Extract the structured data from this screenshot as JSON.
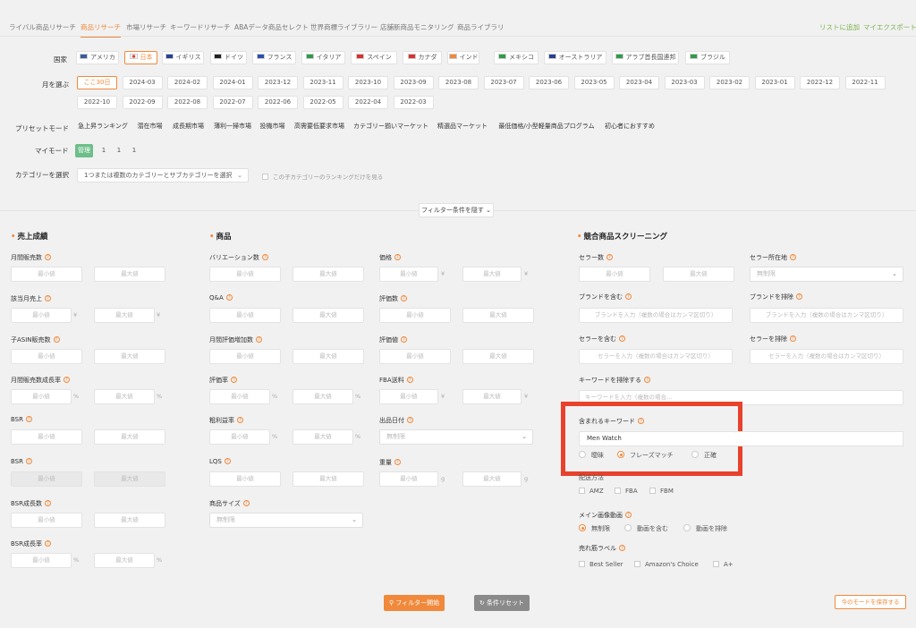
{
  "tabs": [
    "ライバル商品リサーチ",
    "商品リサーチ",
    "市場リサーチ",
    "キーワードリサーチ",
    "ABAデータ商品セレクト",
    "世界商標ライブラリー",
    "店舗新商品モニタリング",
    "商品ライブラリ"
  ],
  "top_links": {
    "add_list": "リストに追加",
    "my_export": "マイエクスポート"
  },
  "country": {
    "label": "国家",
    "items": [
      {
        "name": "アメリカ",
        "flag": "us-flag"
      },
      {
        "name": "日本",
        "flag": "jp-flag"
      },
      {
        "name": "イギリス",
        "flag": "uk-flag"
      },
      {
        "name": "ドイツ",
        "flag": "de-flag"
      },
      {
        "name": "フランス",
        "flag": "fr-flag"
      },
      {
        "name": "イタリア",
        "flag": "it-flag"
      },
      {
        "name": "スペイン",
        "flag": "es-flag"
      },
      {
        "name": "カナダ",
        "flag": "ca-flag"
      },
      {
        "name": "インド",
        "flag": "in-flag"
      },
      {
        "name": "メキシコ",
        "flag": "mx-flag"
      },
      {
        "name": "オーストラリア",
        "flag": "au-flag"
      },
      {
        "name": "アラブ首長国連邦",
        "flag": "ae-flag"
      },
      {
        "name": "ブラジル",
        "flag": "br-flag"
      }
    ],
    "selected": "日本"
  },
  "month": {
    "label": "月を選ぶ",
    "row1": [
      "ここ30日",
      "2024-03",
      "2024-02",
      "2024-01",
      "2023-12",
      "2023-11",
      "2023-10",
      "2023-09",
      "2023-08",
      "2023-07",
      "2023-06",
      "2023-05",
      "2023-04",
      "2023-03",
      "2023-02",
      "2023-01",
      "2022-12",
      "2022-11"
    ],
    "row2": [
      "2022-10",
      "2022-09",
      "2022-08",
      "2022-07",
      "2022-06",
      "2022-05",
      "2022-04",
      "2022-03"
    ],
    "selected": "ここ30日"
  },
  "preset": {
    "label": "プリセットモード",
    "items": [
      "急上昇ランキング",
      "潜在市場",
      "成長期市場",
      "薄利一掃市場",
      "投機市場",
      "高需要低要求市場",
      "カテゴリー揃いマーケット",
      "精選品マーケット",
      "最低価格/小型軽量商品プログラム",
      "初心者におすすめ"
    ]
  },
  "mymode": {
    "label": "マイモード",
    "items": [
      "管理",
      "1",
      "1",
      "1"
    ]
  },
  "category": {
    "label": "カテゴリーを選択",
    "placeholder": "1つまたは複数のカテゴリーとサブカテゴリーを選択",
    "checkbox": "この子カテゴリーのランキングだけを見る"
  },
  "hide_filter": "フィルター条件を隠す",
  "common": {
    "min": "最小値",
    "max": "最大値",
    "yen": "¥",
    "pct": "%",
    "g": "g",
    "no_limit": "無制限"
  },
  "sales": {
    "title": "売上成績",
    "fields": [
      "月間販売数",
      "該当月売上",
      "子ASIN販売数",
      "月間販売数成長率",
      "BSR",
      "BSR",
      "BSR成長数",
      "BSR成長率"
    ]
  },
  "product": {
    "title": "商品",
    "left": [
      "バリエーション数",
      "Q&A",
      "月間評価増加数",
      "評価率",
      "粗利益率",
      "LQS",
      "商品サイズ"
    ],
    "right": [
      "価格",
      "評価数",
      "評価値",
      "FBA送料",
      "出品日付",
      "重量"
    ]
  },
  "competition": {
    "title": "競合商品スクリーニング",
    "seller_count": "セラー数",
    "seller_location": "セラー所在地",
    "brand_include": "ブランドを含む",
    "brand_exclude": "ブランドを排除",
    "brand_placeholder": "ブランドを入力（複数の場合はカンマ区切り）",
    "seller_include": "セラーを含む",
    "seller_exclude": "セラーを排除",
    "seller_placeholder": "セラーを入力（複数の場合はカンマ区切り）",
    "keyword_exclude": "キーワードを排除する",
    "keyword_exclude_placeholder": "キーワードを入力（複数の場合…",
    "keyword_include": "含まれるキーワード",
    "keyword_value": "Men Watch",
    "match_options": [
      "曖昧",
      "フレーズマッチ",
      "正確"
    ],
    "match_selected": "フレーズマッチ",
    "delivery_label": "配送方法",
    "delivery_options": [
      "AMZ",
      "FBA",
      "FBM"
    ],
    "main_video_label": "メイン画像動画",
    "main_video_options": [
      "無制限",
      "動画を含む",
      "動画を排除"
    ],
    "main_video_selected": "無制限",
    "bestseller_label": "売れ筋ラベル",
    "bestseller_options": [
      "Best Seller",
      "Amazon's Choice",
      "A+"
    ]
  },
  "actions": {
    "start": "フィルター開始",
    "reset": "条件リセット",
    "save_mode": "今のモードを保存する"
  },
  "colors": {
    "accent": "#f0893b",
    "green": "#6dbf8a",
    "highlight": "#e8412c"
  }
}
